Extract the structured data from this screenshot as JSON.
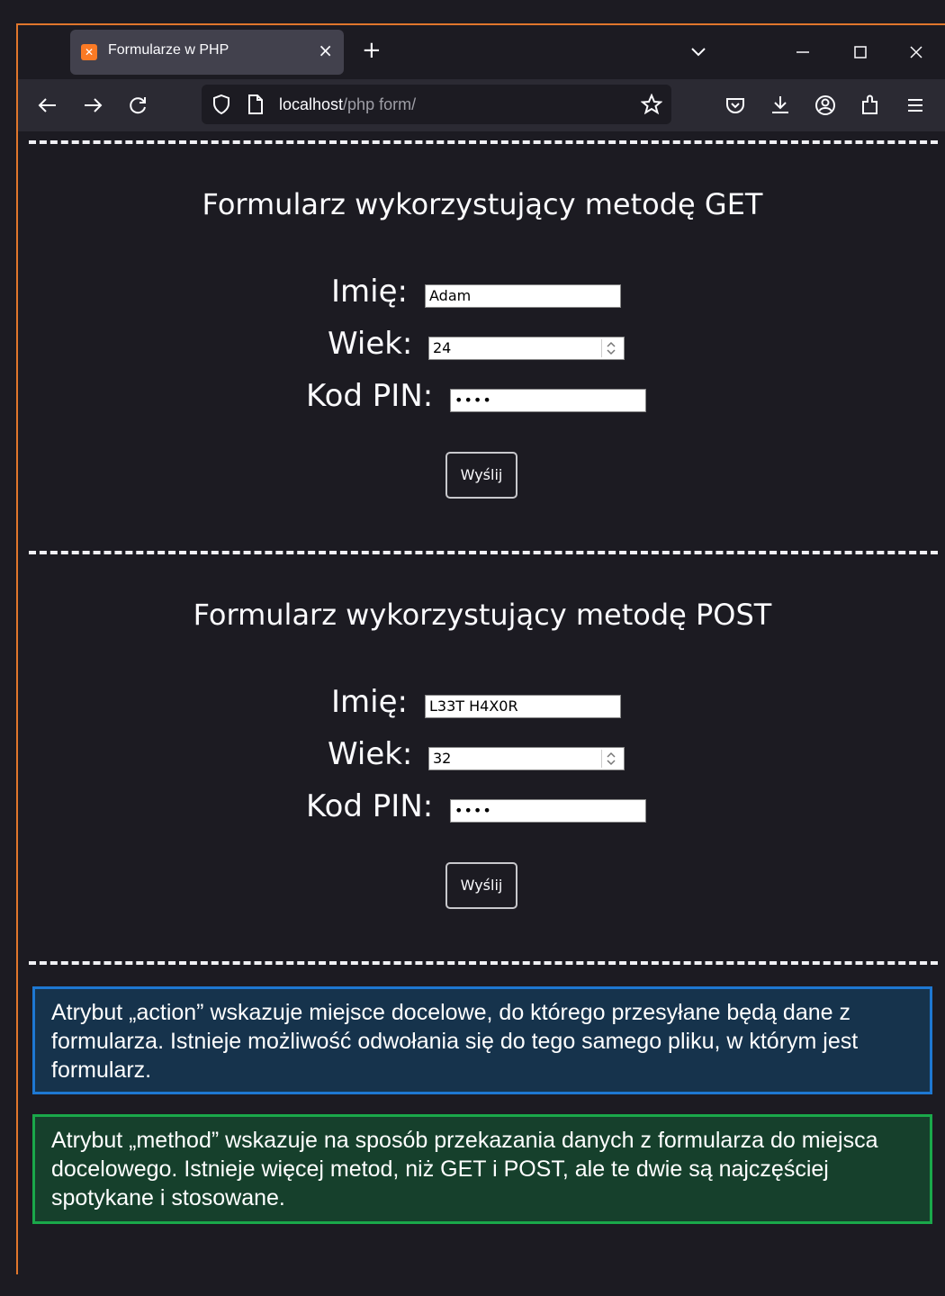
{
  "browser": {
    "tab_title": "Formularze w PHP",
    "url_host": "localhost",
    "url_path": "/php form/"
  },
  "forms": [
    {
      "title": "Formularz wykorzystujący metodę GET",
      "name_label": "Imię:",
      "name_value": "Adam",
      "age_label": "Wiek:",
      "age_value": "24",
      "pin_label": "Kod PIN:",
      "pin_value": "••••",
      "submit_label": "Wyślij"
    },
    {
      "title": "Formularz wykorzystujący metodę POST",
      "name_label": "Imię:",
      "name_value": "L33T H4X0R",
      "age_label": "Wiek:",
      "age_value": "32",
      "pin_label": "Kod PIN:",
      "pin_value": "••••",
      "submit_label": "Wyślij"
    }
  ],
  "notes": {
    "action": "Atrybut „action” wskazuje miejsce docelowe, do którego przesyłane będą dane z formularza. Istnieje możliwość odwołania się do tego samego pliku, w którym jest formularz.",
    "method": "Atrybut „method” wskazuje na sposób przekazania danych z formularza do miejsca docelowego. Istnieje więcej metod, niż GET i POST, ale te dwie są najczęściej spotykane i stosowane."
  },
  "colors": {
    "window_accent": "#e0762c",
    "note_action_border": "#1e78d2",
    "note_method_border": "#1aa84a"
  }
}
